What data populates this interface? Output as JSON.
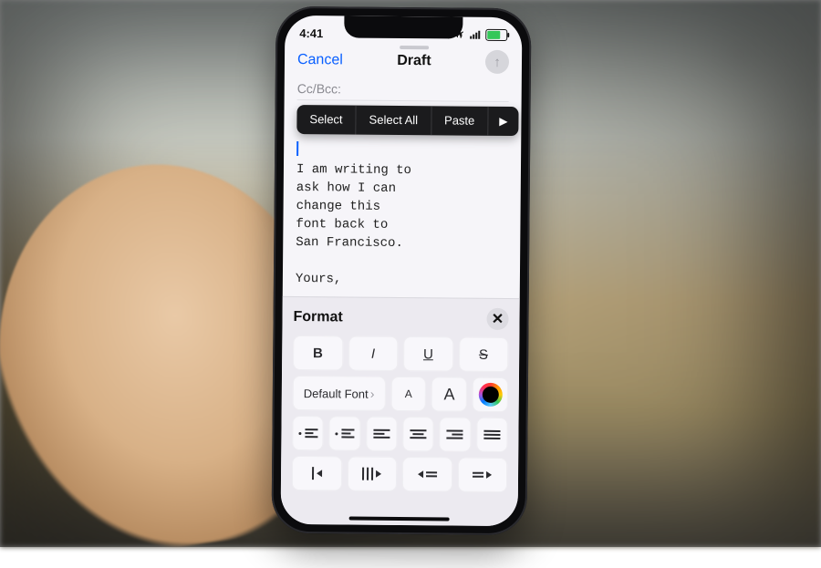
{
  "status": {
    "time": "4:41"
  },
  "nav": {
    "cancel": "Cancel",
    "title": "Draft"
  },
  "fields": {
    "ccbcc_label": "Cc/Bcc:"
  },
  "edit_menu": {
    "select": "Select",
    "select_all": "Select All",
    "paste": "Paste"
  },
  "body": {
    "text": "I am writing to\nask how I can\nchange this\nfont back to\nSan Francisco.\n\nYours,"
  },
  "format": {
    "title": "Format",
    "bold": "B",
    "italic": "I",
    "underline": "U",
    "strike": "S",
    "font_label": "Default Font",
    "small_a": "A",
    "big_a": "A"
  }
}
